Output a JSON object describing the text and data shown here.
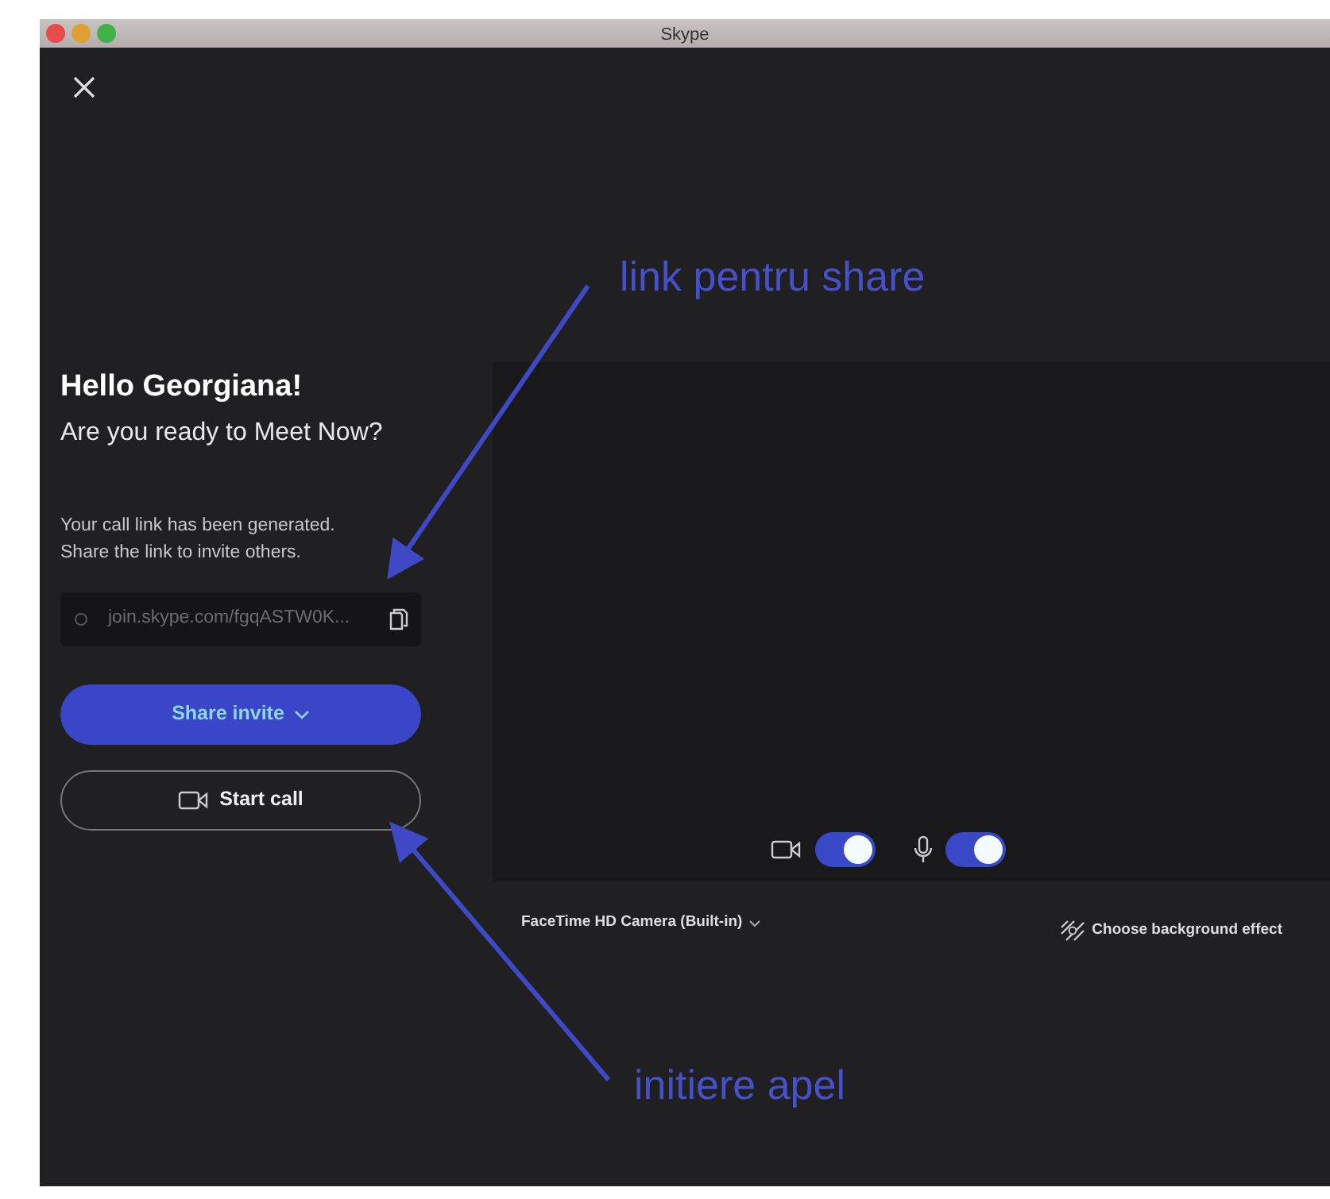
{
  "window": {
    "title": "Skype"
  },
  "greeting": {
    "title": "Hello Georgiana!",
    "subtitle": "Are you ready to Meet Now?"
  },
  "link_section": {
    "message_lines": [
      "Your call link has been generated.",
      "Share the link to invite others."
    ],
    "link": "join.skype.com/fgqASTW0K..."
  },
  "buttons": [
    {
      "label": "Share invite",
      "kind": "primary"
    },
    {
      "label": "Start call",
      "kind": "outline"
    }
  ],
  "preview": {
    "toggles": [
      {
        "kind": "camera",
        "on": true
      },
      {
        "kind": "mic",
        "on": true
      }
    ],
    "camera_select": "FaceTime HD Camera (Built-in)",
    "background_effect": "Choose background effect"
  },
  "annotations": [
    {
      "text": "link pentru share"
    },
    {
      "text": "initiere apel"
    }
  ]
}
